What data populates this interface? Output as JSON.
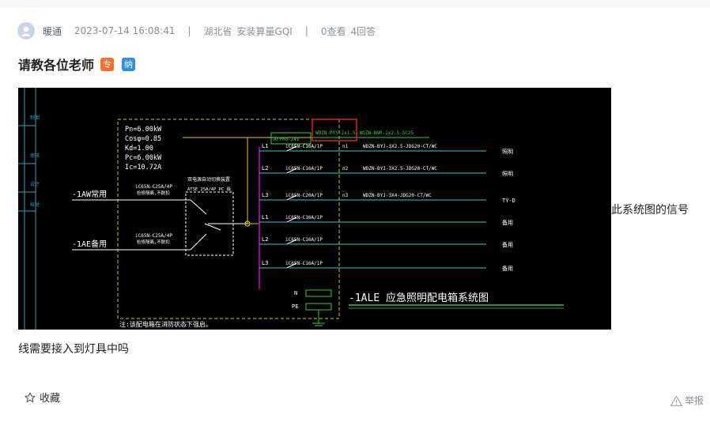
{
  "post": {
    "author": "暖通",
    "datetime": "2023-07-14 16:08:41",
    "separator": "|",
    "province": "湖北省",
    "category": "安装算量GQI",
    "views": "0查看",
    "answers": "4回答",
    "title": "请教各位老师",
    "badge_zhuan": "专",
    "badge_na": "纳",
    "text_inline": "此系统图的信号",
    "text_continued": "线需要接入到灯具中吗"
  },
  "actions": {
    "favorite": "收藏",
    "report": "举报"
  },
  "cad": {
    "params": [
      "Pn=6.00kW",
      "Cosφ=0.85",
      "Kd=1.00",
      "Pc=6.00kW",
      "Ic=10.72A"
    ],
    "feed_normal": "-1AW常用",
    "feed_backup": "-1AE备用",
    "breaker_note": "iC65N-C25A/4P",
    "breaker_sub": "检修隔离,不脱扣",
    "ats_title": "双电源自动切换装置",
    "ats_labels": "ATSE   25A/4P   PC 级",
    "top_label": "WDZN-RYS-2x1.5",
    "top_label2": "-WDZN-BNR-2x2.5-SC25",
    "box_label": "AFPM0-24V",
    "circuits": [
      {
        "phase": "L1",
        "breaker": "iC65N-C16A/1P",
        "no": "n1",
        "cable": "WDZN-BYJ-3X2.5-JDG20-CT/WC",
        "load": "照明"
      },
      {
        "phase": "L2",
        "breaker": "iC65N-C16A/1P",
        "no": "n2",
        "cable": "WDZN-BYJ-3X2.5-JDG20-CT/WC",
        "load": "照明"
      },
      {
        "phase": "L3",
        "breaker": "iC65N-C20A/1P",
        "no": "n3",
        "cable": "WDZN-BYJ-3X4-JDG20-CT/WC",
        "load": "TY-D"
      },
      {
        "phase": "L1",
        "breaker": "iC65N-C16A/1P",
        "no": "",
        "cable": "",
        "load": "备用"
      },
      {
        "phase": "L2",
        "breaker": "iC65N-C16A/1P",
        "no": "",
        "cable": "",
        "load": "备用"
      },
      {
        "phase": "L3",
        "breaker": "iC65N-C16A/1P",
        "no": "",
        "cable": "",
        "load": "备用"
      }
    ],
    "n_label": "N",
    "pe_label": "PE",
    "diagram_title": "-1ALE  应急照明配电箱系统图",
    "footnote": "注:该配电箱在消防状态下强启。",
    "side_labels": [
      "制图",
      "审核",
      "设计",
      "校对"
    ]
  }
}
